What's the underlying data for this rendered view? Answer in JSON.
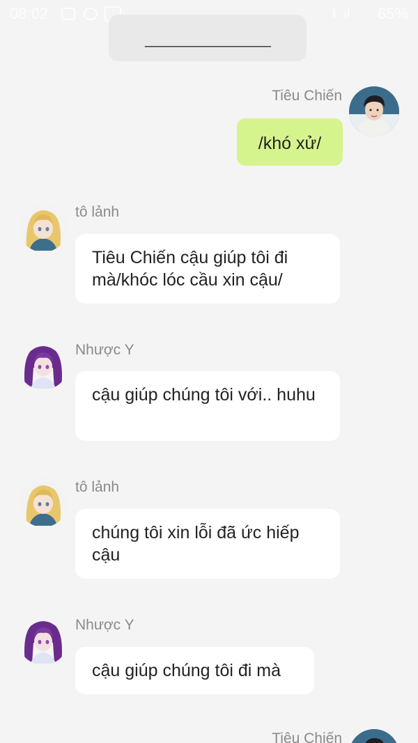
{
  "status_bar": {
    "time": "08:02",
    "battery": "65%",
    "signal": "ℹ .ıl"
  },
  "system_message": "________________",
  "messages": [
    {
      "sender": "Tiêu Chiến",
      "text": "/khó xử/",
      "side": "right",
      "avatar": "boy"
    },
    {
      "sender": "tô lảnh",
      "text": "Tiêu Chiến cậu giúp tôi đi mà/khóc lóc cầu xin cậu/",
      "side": "left",
      "avatar": "blonde"
    },
    {
      "sender": "Nhược Y",
      "text": "cậu giúp chúng tôi với.. huhu",
      "side": "left",
      "avatar": "purple"
    },
    {
      "sender": "tô lảnh",
      "text": "chúng tôi xin lỗi đã ức hiếp cậu",
      "side": "left",
      "avatar": "blonde"
    },
    {
      "sender": "Nhược Y",
      "text": "cậu giúp chúng tôi đi mà",
      "side": "left",
      "avatar": "purple"
    },
    {
      "sender": "Tiêu Chiến",
      "text": "",
      "side": "right",
      "avatar": "boy"
    }
  ],
  "colors": {
    "background": "#f4f4f4",
    "bubble_me": "#d6f48e",
    "bubble_other": "#ffffff",
    "sender_text": "#8a8a8a"
  }
}
